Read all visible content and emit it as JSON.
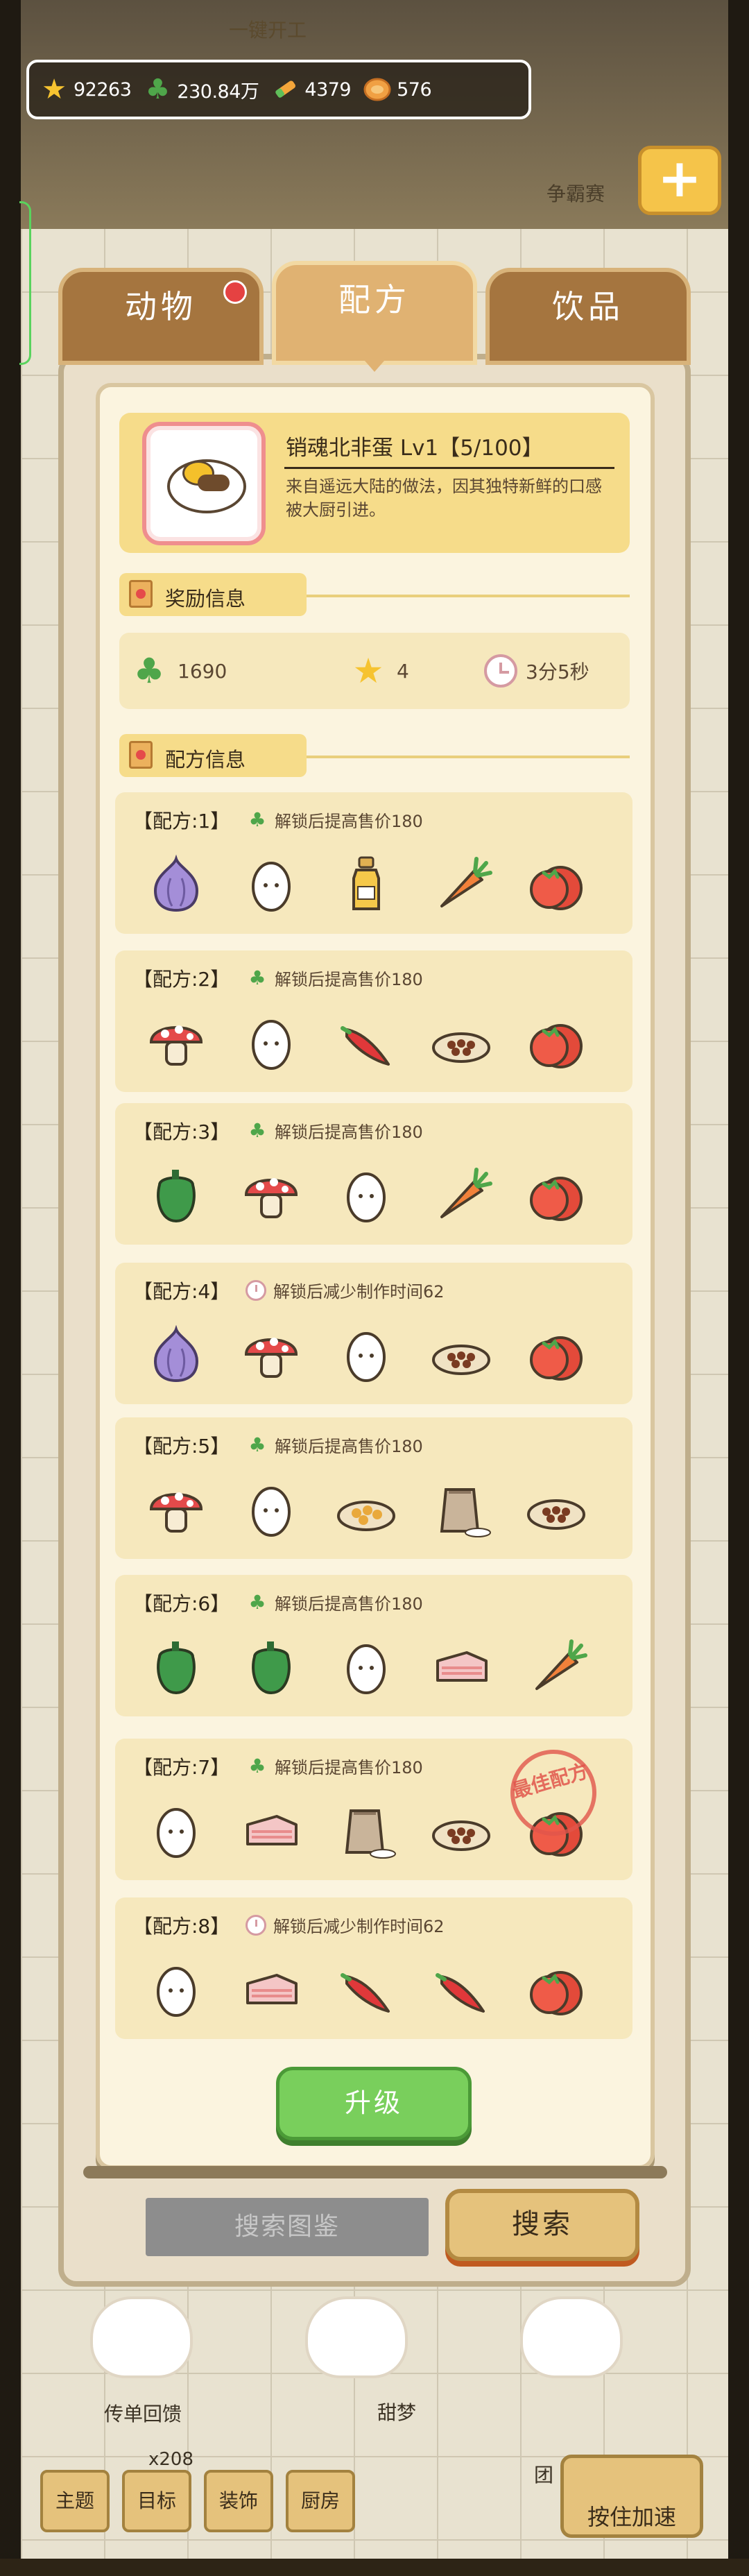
{
  "top": {
    "banner_label": "一键开工",
    "compete_label": "争霸赛"
  },
  "resources": [
    {
      "icon": "star-icon",
      "value": "92263"
    },
    {
      "icon": "clover-icon",
      "value": "230.84万"
    },
    {
      "icon": "crayon-icon",
      "value": "4379"
    },
    {
      "icon": "coin-icon",
      "value": "576"
    }
  ],
  "tabs": [
    {
      "label": "动物",
      "badge": true
    },
    {
      "label": "配方",
      "active": true
    },
    {
      "label": "饮品"
    }
  ],
  "recipe": {
    "title": "销魂北非蛋 Lv1【5/100】",
    "description": "来自遥远大陆的做法，因其独特新鲜的口感被大厨引进。"
  },
  "sections": {
    "rewards": "奖励信息",
    "formulas": "配方信息"
  },
  "rewards": {
    "clover": "1690",
    "star": "4",
    "time": "3分5秒"
  },
  "formulas": [
    {
      "name": "【配方:1】",
      "bonus_type": "clover",
      "bonus": "解锁后提高售价180",
      "ingredients": [
        "onion",
        "egg",
        "oil",
        "carrot",
        "tomato"
      ]
    },
    {
      "name": "【配方:2】",
      "bonus_type": "clover",
      "bonus": "解锁后提高售价180",
      "ingredients": [
        "mushroom",
        "egg",
        "chili",
        "beans",
        "tomato"
      ]
    },
    {
      "name": "【配方:3】",
      "bonus_type": "clover",
      "bonus": "解锁后提高售价180",
      "ingredients": [
        "pepper",
        "mushroom",
        "egg",
        "carrot",
        "tomato"
      ]
    },
    {
      "name": "【配方:4】",
      "bonus_type": "clock",
      "bonus": "解锁后减少制作时间62",
      "ingredients": [
        "onion",
        "mushroom",
        "egg",
        "beans",
        "tomato"
      ]
    },
    {
      "name": "【配方:5】",
      "bonus_type": "clover",
      "bonus": "解锁后提高售价180",
      "ingredients": [
        "mushroom",
        "egg",
        "chickpeas",
        "flour",
        "beans"
      ]
    },
    {
      "name": "【配方:6】",
      "bonus_type": "clover",
      "bonus": "解锁后提高售价180",
      "ingredients": [
        "pepper",
        "pepper",
        "egg",
        "meat",
        "carrot"
      ]
    },
    {
      "name": "【配方:7】",
      "bonus_type": "clover",
      "bonus": "解锁后提高售价180",
      "ingredients": [
        "egg",
        "meat",
        "flour",
        "beans",
        "tomato"
      ],
      "stamp": "最佳配方"
    },
    {
      "name": "【配方:8】",
      "bonus_type": "clock",
      "bonus": "解锁后减少制作时间62",
      "ingredients": [
        "egg",
        "meat",
        "chili",
        "chili",
        "tomato"
      ]
    }
  ],
  "buttons": {
    "upgrade": "升级",
    "search_dict": "搜索图鉴",
    "search": "搜索"
  },
  "bottom": {
    "left_text": "传单回馈",
    "count": "x208",
    "mid_text": "甜梦",
    "badge_text": "团",
    "nav": [
      "主题",
      "目标",
      "装饰",
      "厨房"
    ],
    "boost": "按住加速"
  },
  "colors": {
    "accent_green": "#79cf5c",
    "panel": "#fbf4df",
    "card": "#f6e8bd",
    "header": "#f6dc8a"
  }
}
